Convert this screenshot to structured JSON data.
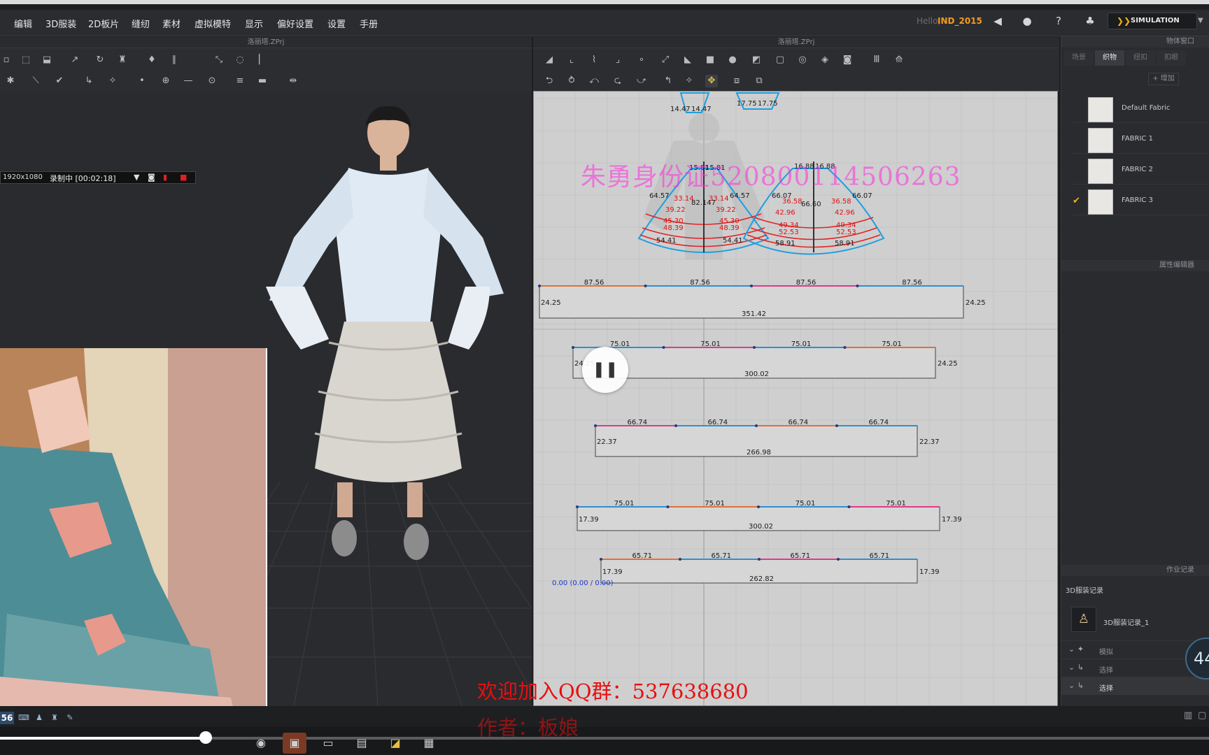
{
  "menu": {
    "items": [
      "编辑",
      "3D服装",
      "2D板片",
      "缝纫",
      "素材",
      "虚拟模特",
      "显示",
      "偏好设置",
      "设置",
      "手册"
    ],
    "user_label": "Hello,",
    "project_name": "IND_2015",
    "simulation_label": "SIMULATION"
  },
  "panels": {
    "left_title": "洛丽塔.ZPrj",
    "right_title": "洛丽塔.ZPrj"
  },
  "recorder": {
    "resolution": "1920x1080",
    "status": "录制中 [00:02:18]"
  },
  "pattern_window": {
    "watermark": "朱勇身份证520800114506263",
    "pieces": [
      {
        "top": [
          "87.56",
          "87.56",
          "87.56",
          "87.56"
        ],
        "side": "24.25",
        "bottom": "351.42"
      },
      {
        "top": [
          "75.01",
          "75.01",
          "75.01",
          "75.01"
        ],
        "side": "24.25",
        "bottom": "300.02"
      },
      {
        "top": [
          "66.74",
          "66.74",
          "66.74",
          "66.74"
        ],
        "side": "22.37",
        "bottom": "266.98"
      },
      {
        "top": [
          "75.01",
          "75.01",
          "75.01",
          "75.01"
        ],
        "side": "17.39",
        "bottom": "300.02"
      },
      {
        "top": [
          "65.71",
          "65.71",
          "65.71",
          "65.71"
        ],
        "side": "17.39",
        "bottom": "262.82"
      }
    ],
    "skirt_labels": {
      "top": [
        "14.47",
        "14.47",
        "17.75",
        "17.75"
      ],
      "waist": [
        "15.81",
        "15.81",
        "16.88",
        "16.88"
      ],
      "left_outer": [
        "64.57",
        "64.57"
      ],
      "left_inner": [
        "33.14",
        "33.14"
      ],
      "left_rows": [
        "39.22",
        "39.22",
        "45.30",
        "45.30",
        "48.39",
        "48.39"
      ],
      "left_center": "82.147",
      "left_hem": [
        "54.41",
        "54.41"
      ],
      "right_outer": [
        "66.07",
        "66.07"
      ],
      "right_inner": [
        "36.58",
        "36.58"
      ],
      "right_center": "66.60",
      "right_rows": [
        "42.96",
        "42.96",
        "49.34",
        "49.34",
        "52.53",
        "52.53"
      ],
      "right_hem": [
        "58.91",
        "58.91"
      ]
    },
    "coordinate": "0.00 (0.00 / 0.00)"
  },
  "right_panel": {
    "object_window_title": "物体窗口",
    "tabs": [
      "场景",
      "织物",
      "纽扣",
      "扣眼"
    ],
    "active_tab": 1,
    "add_label": "+ 增加",
    "fabrics": [
      "Default Fabric",
      "FABRIC 1",
      "FABRIC 2",
      "FABRIC 3"
    ],
    "checked_fabric": 3,
    "property_editor_title": "属性编辑器",
    "history_panel_title": "作业记录",
    "history_title": "3D服装记录",
    "history_item": "3D服装记录_1",
    "actions": [
      "模拟",
      "选择",
      "选择"
    ],
    "counter": "44"
  },
  "bottom": {
    "tool_number": "56",
    "qq_group": "欢迎加入QQ群：537638680",
    "author": "作者：板娘",
    "progress": 0.17
  },
  "colors": {
    "accent": "#f29a1f",
    "watermark": "#ff2de0",
    "qq_text": "#e80f0f",
    "pattern_bg": "#cfcfcf"
  }
}
